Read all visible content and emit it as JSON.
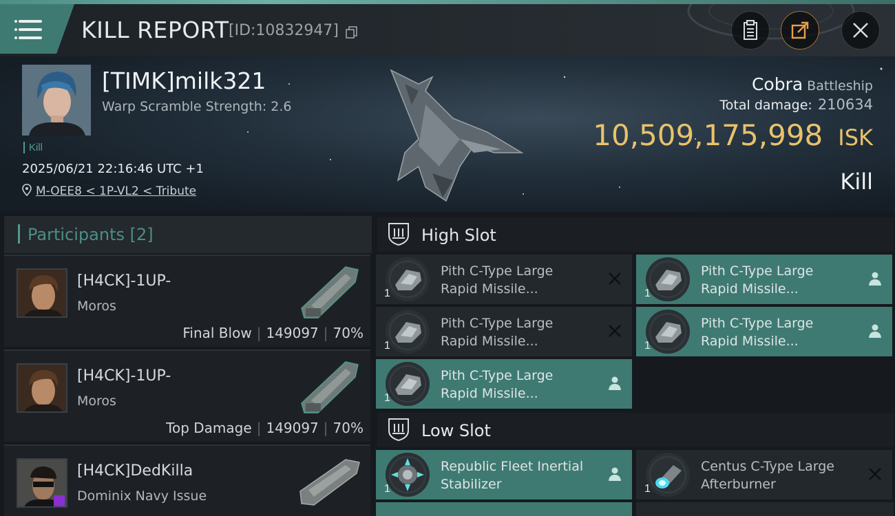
{
  "header": {
    "title": "KILL REPORT",
    "id_label": "[ID:10832947]"
  },
  "victim": {
    "name": "[TIMK]milk321",
    "warp_scramble": "Warp Scramble Strength: 2.6",
    "tag": "Kill",
    "datetime": "2025/06/21 22:16:46 UTC +1",
    "location": "M-OEE8 < 1P-VL2 < Tribute",
    "ship_name": "Cobra",
    "ship_class": "Battleship",
    "total_damage_label": "Total damage:",
    "total_damage": "210634",
    "isk_value": "10,509,175,998",
    "isk_unit": "ISK",
    "result": "Kill"
  },
  "participants": {
    "label": "Participants",
    "count": "[2]",
    "items": [
      {
        "name": "[H4CK]-1UP-",
        "ship": "Moros",
        "role": "Final Blow",
        "damage": "149097",
        "percent": "70%"
      },
      {
        "name": "[H4CK]-1UP-",
        "ship": "Moros",
        "role": "Top Damage",
        "damage": "149097",
        "percent": "70%"
      },
      {
        "name": "[H4CK]DedKilla",
        "ship": "Dominix Navy Issue"
      }
    ]
  },
  "high_slot": {
    "label": "High Slot",
    "modules": [
      {
        "line1": "Pith C-Type Large",
        "line2": "Rapid Missile...",
        "qty": "1",
        "state": "destroyed"
      },
      {
        "line1": "Pith C-Type Large",
        "line2": "Rapid Missile...",
        "qty": "1",
        "state": "dropped"
      },
      {
        "line1": "Pith C-Type Large",
        "line2": "Rapid Missile...",
        "qty": "1",
        "state": "destroyed"
      },
      {
        "line1": "Pith C-Type Large",
        "line2": "Rapid Missile...",
        "qty": "1",
        "state": "dropped"
      },
      {
        "line1": "Pith C-Type Large",
        "line2": "Rapid Missile...",
        "qty": "1",
        "state": "dropped"
      }
    ]
  },
  "low_slot": {
    "label": "Low Slot",
    "modules": [
      {
        "line1": "Republic Fleet Inertial",
        "line2": "Stabilizer",
        "qty": "1",
        "state": "dropped"
      },
      {
        "line1": "Centus C-Type Large",
        "line2": "Afterburner",
        "qty": "1",
        "state": "destroyed"
      }
    ]
  },
  "colors": {
    "accent_teal": "#3e7a72",
    "isk_gold": "#e9c26b"
  },
  "icons": [
    "menu-icon",
    "copy-icon",
    "clipboard-icon",
    "share-icon",
    "close-icon",
    "location-pin-icon",
    "shield-slot-icon",
    "person-icon",
    "x-mark-icon"
  ]
}
